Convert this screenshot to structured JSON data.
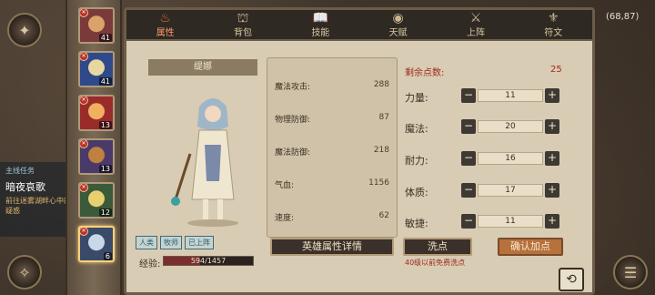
{
  "tabs": [
    {
      "label": "属性",
      "icon": "flame-icon",
      "glyph": "♨",
      "active": true
    },
    {
      "label": "背包",
      "icon": "bag-icon",
      "glyph": "⛫",
      "active": false
    },
    {
      "label": "技能",
      "icon": "book-icon",
      "glyph": "📖",
      "active": false
    },
    {
      "label": "天赋",
      "icon": "eye-icon",
      "glyph": "◉",
      "active": false
    },
    {
      "label": "上阵",
      "icon": "swords-icon",
      "glyph": "⚔",
      "active": false
    },
    {
      "label": "符文",
      "icon": "rune-icon",
      "glyph": "⚜",
      "active": false
    }
  ],
  "heroes": [
    {
      "level": "41",
      "colors": [
        "#7a3a3a",
        "#d9a36b"
      ]
    },
    {
      "level": "41",
      "colors": [
        "#2e4a8a",
        "#e8d7a0"
      ]
    },
    {
      "level": "13",
      "colors": [
        "#9a2b2b",
        "#f0b060"
      ]
    },
    {
      "level": "13",
      "colors": [
        "#4a3a6a",
        "#c08040"
      ]
    },
    {
      "level": "12",
      "colors": [
        "#3a5a3a",
        "#e8d070"
      ]
    },
    {
      "level": "6",
      "colors": [
        "#3a4a6a",
        "#c8d8e8"
      ],
      "selected": true
    }
  ],
  "hero": {
    "name": "缇娜",
    "tags": [
      "人类",
      "牧师",
      "已上阵"
    ],
    "exp_label": "经验:",
    "exp_text": "594/1457",
    "exp_progress": 0.41
  },
  "stats": [
    {
      "label": "魔法攻击:",
      "value": "288"
    },
    {
      "label": "物理防御:",
      "value": "87"
    },
    {
      "label": "魔法防御:",
      "value": "218"
    },
    {
      "label": "气血:",
      "value": "1156"
    },
    {
      "label": "速度:",
      "value": "62"
    }
  ],
  "remaining": {
    "label": "剩余点数:",
    "value": "25"
  },
  "attributes": [
    {
      "label": "力量:",
      "value": "11"
    },
    {
      "label": "魔法:",
      "value": "20"
    },
    {
      "label": "耐力:",
      "value": "16"
    },
    {
      "label": "体质:",
      "value": "17"
    },
    {
      "label": "敏捷:",
      "value": "11"
    }
  ],
  "buttons": {
    "detail": "英雄属性详情",
    "wash": "洗点",
    "confirm": "确认加点",
    "free_note": "40级以前免费洗点",
    "back": "⟲"
  },
  "quest": {
    "title": "主线任务",
    "name": "暗夜哀歌",
    "desc": "前往迷雾湖畔心中的疑惑"
  },
  "coords": "(68,87)"
}
